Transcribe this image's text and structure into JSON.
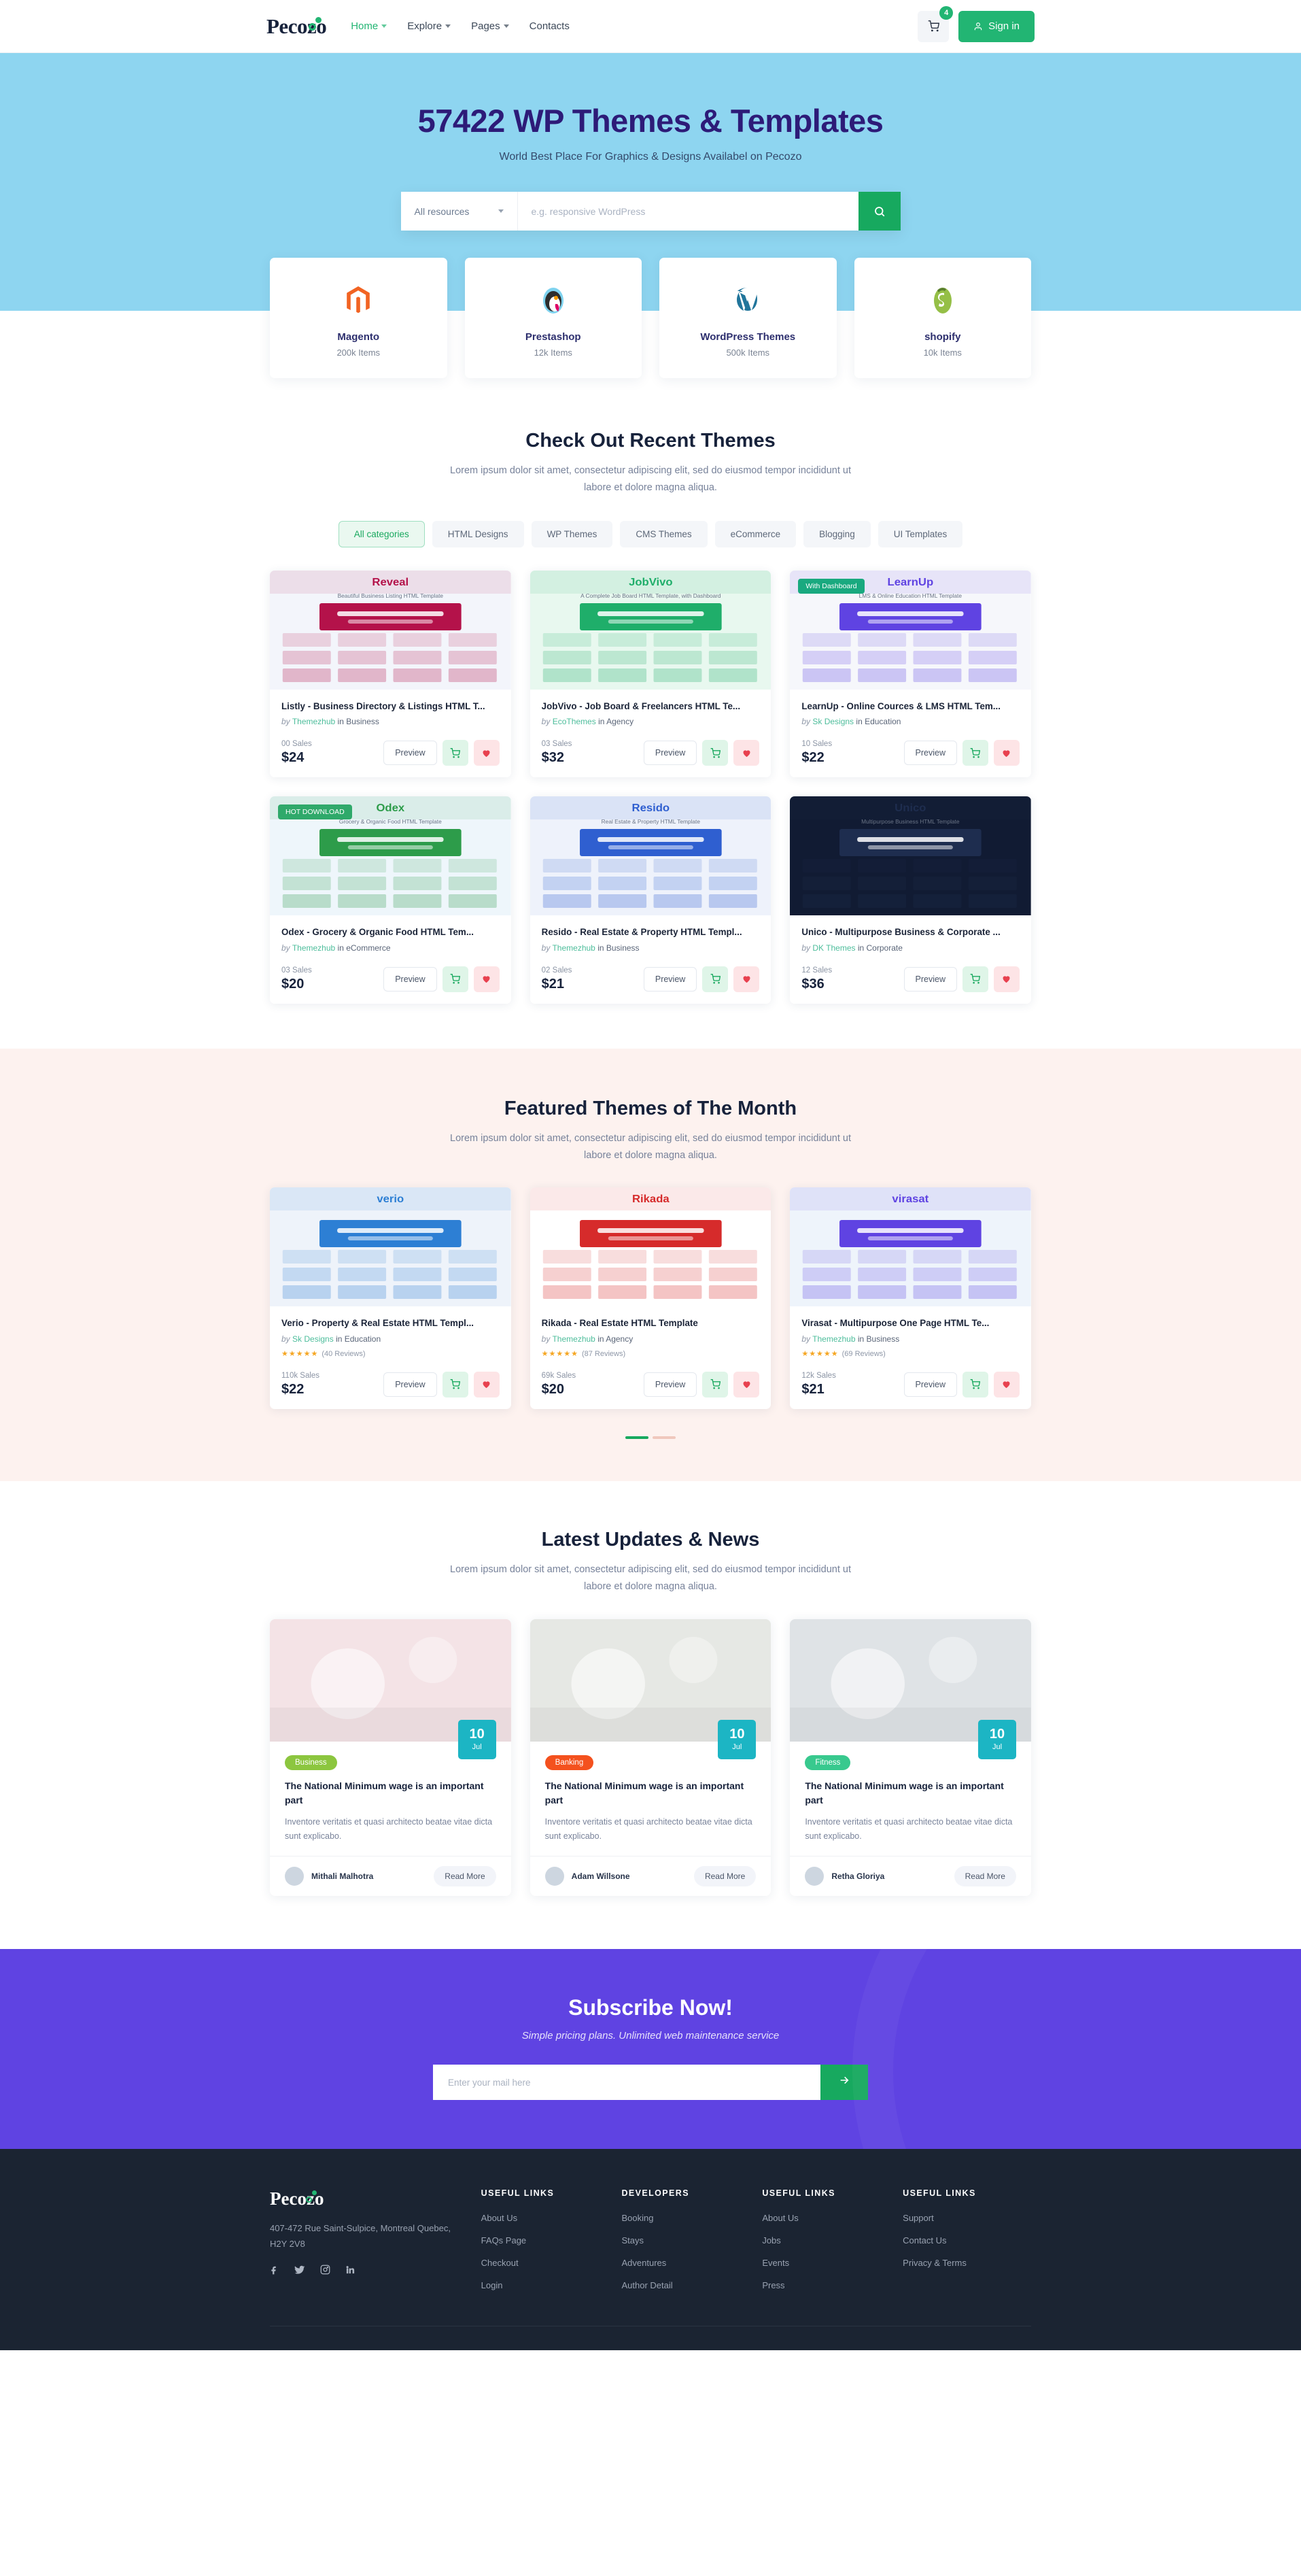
{
  "header": {
    "logo": "Pecozo",
    "nav": [
      {
        "label": "Home",
        "caret": true,
        "active": true
      },
      {
        "label": "Explore",
        "caret": true,
        "active": false
      },
      {
        "label": "Pages",
        "caret": true,
        "active": false
      },
      {
        "label": "Contacts",
        "caret": false,
        "active": false
      }
    ],
    "cart_count": "4",
    "signin_label": "Sign in"
  },
  "hero": {
    "title": "57422 WP Themes & Templates",
    "subtitle": "World Best Place For Graphics & Designs Availabel on Pecozo",
    "select_value": "All resources",
    "search_placeholder": "e.g. responsive WordPress",
    "search_icon": "search-icon"
  },
  "categories": [
    {
      "name": "Magento",
      "items": "200k Items",
      "icon": "magento-icon",
      "color": "#f26322"
    },
    {
      "name": "Prestashop",
      "items": "12k Items",
      "icon": "prestashop-icon",
      "color": "#df0067"
    },
    {
      "name": "WordPress Themes",
      "items": "500k Items",
      "icon": "wordpress-icon",
      "color": "#21759b"
    },
    {
      "name": "shopify",
      "items": "10k Items",
      "icon": "shopify-icon",
      "color": "#95bf47"
    }
  ],
  "recent": {
    "title": "Check Out Recent Themes",
    "desc": "Lorem ipsum dolor sit amet, consectetur adipiscing elit, sed do eiusmod tempor incididunt ut labore et dolore magna aliqua.",
    "tabs": [
      "All categories",
      "HTML Designs",
      "WP Themes",
      "CMS Themes",
      "eCommerce",
      "Blogging",
      "UI Templates"
    ],
    "active_tab": "All categories",
    "items": [
      {
        "title": "Listly - Business Directory & Listings HTML T...",
        "author": "Themezhub",
        "category": "Business",
        "sales": "00 Sales",
        "price": "$24",
        "preview": "Preview",
        "badge": "",
        "thumb_title": "Reveal",
        "thumb_sub": "Beautiful Business Listing HTML Template",
        "thumb_bg": "#f3f5fb",
        "accent": "#b4124a"
      },
      {
        "title": "JobVivo - Job Board & Freelancers HTML Te...",
        "author": "EcoThemes",
        "category": "Agency",
        "sales": "03 Sales",
        "price": "$32",
        "preview": "Preview",
        "badge": "",
        "thumb_title": "JobVivo",
        "thumb_sub": "A Complete Job Board HTML Template, with Dashboard",
        "thumb_bg": "#e8f8ef",
        "accent": "#1fae6a"
      },
      {
        "title": "LearnUp - Online Cources & LMS HTML Tem...",
        "author": "Sk Designs",
        "category": "Education",
        "sales": "10 Sales",
        "price": "$22",
        "preview": "Preview",
        "badge": "With Dashboard",
        "thumb_title": "LearnUp",
        "thumb_sub": "LMS & Online Education HTML Template",
        "thumb_bg": "#f6f7fb",
        "accent": "#5f43e2"
      },
      {
        "title": "Odex - Grocery & Organic Food HTML Tem...",
        "author": "Themezhub",
        "category": "eCommerce",
        "sales": "03 Sales",
        "price": "$20",
        "preview": "Preview",
        "badge": "HOT DOWNLOAD",
        "thumb_title": "Odex",
        "thumb_sub": "Grocery & Organic Food HTML Template",
        "thumb_bg": "#eef6fb",
        "accent": "#2d9c4a"
      },
      {
        "title": "Resido - Real Estate & Property HTML Templ...",
        "author": "Themezhub",
        "category": "Business",
        "sales": "02 Sales",
        "price": "$21",
        "preview": "Preview",
        "badge": "",
        "thumb_title": "Resido",
        "thumb_sub": "Real Estate & Property HTML Template",
        "thumb_bg": "#eef2fb",
        "accent": "#2f5fd0"
      },
      {
        "title": "Unico - Multipurpose Business & Corporate ...",
        "author": "DK Themes",
        "category": "Corporate",
        "sales": "12 Sales",
        "price": "$36",
        "preview": "Preview",
        "badge": "",
        "thumb_title": "Unico",
        "thumb_sub": "Multipurpose Business HTML Template",
        "thumb_bg": "#111b33",
        "accent": "#1e2d4f"
      }
    ]
  },
  "featured": {
    "title": "Featured Themes of The Month",
    "desc": "Lorem ipsum dolor sit amet, consectetur adipiscing elit, sed do eiusmod tempor incididunt ut labore et dolore magna aliqua.",
    "items": [
      {
        "title": "Verio - Property & Real Estate HTML Templ...",
        "author": "Sk Designs",
        "category": "Education",
        "stars": "★★★★★",
        "reviews": "(40 Reviews)",
        "sales": "110k Sales",
        "price": "$22",
        "preview": "Preview",
        "thumb_title": "verio",
        "thumb_bg": "#eef3fa",
        "accent": "#2d7fd4"
      },
      {
        "title": "Rikada - Real Estate HTML Template",
        "author": "Themezhub",
        "category": "Agency",
        "stars": "★★★★★",
        "reviews": "(87 Reviews)",
        "sales": "69k Sales",
        "price": "$20",
        "preview": "Preview",
        "thumb_title": "Rikada",
        "thumb_bg": "#ffffff",
        "accent": "#d62b2b"
      },
      {
        "title": "Virasat - Multipurpose One Page HTML Te...",
        "author": "Themezhub",
        "category": "Business",
        "stars": "★★★★★",
        "reviews": "(69 Reviews)",
        "sales": "12k Sales",
        "price": "$21",
        "preview": "Preview",
        "thumb_title": "virasat",
        "thumb_bg": "#eef4fb",
        "accent": "#5f43e2"
      }
    ]
  },
  "news": {
    "title": "Latest Updates & News",
    "desc": "Lorem ipsum dolor sit amet, consectetur adipiscing elit, sed do eiusmod tempor incididunt ut labore et dolore magna aliqua.",
    "items": [
      {
        "tag": "Business",
        "tag_color": "#8cc63f",
        "day": "10",
        "month": "Jul",
        "title": "The National Minimum wage is an important part",
        "excerpt": "Inventore veritatis et quasi architecto beatae vitae dicta sunt explicabo.",
        "author": "Mithali Malhotra",
        "read_more": "Read More",
        "img_bg": "#f4e3e6"
      },
      {
        "tag": "Banking",
        "tag_color": "#f4511e",
        "day": "10",
        "month": "Jul",
        "title": "The National Minimum wage is an important part",
        "excerpt": "Inventore veritatis et quasi architecto beatae vitae dicta sunt explicabo.",
        "author": "Adam Willsone",
        "read_more": "Read More",
        "img_bg": "#e6e8e4"
      },
      {
        "tag": "Fitness",
        "tag_color": "#38c98e",
        "day": "10",
        "month": "Jul",
        "title": "The National Minimum wage is an important part",
        "excerpt": "Inventore veritatis et quasi architecto beatae vitae dicta sunt explicabo.",
        "author": "Retha Gloriya",
        "read_more": "Read More",
        "img_bg": "#dfe3e6"
      }
    ]
  },
  "subscribe": {
    "title": "Subscribe Now!",
    "subtitle": "Simple pricing plans. Unlimited web maintenance service",
    "placeholder": "Enter your mail here",
    "button_icon": "arrow-right-icon"
  },
  "footer": {
    "logo": "Pecozo",
    "address": "407-472 Rue Saint-Sulpice, Montreal Quebec, H2Y 2V8",
    "socials": [
      "facebook-icon",
      "twitter-icon",
      "instagram-icon",
      "linkedin-icon"
    ],
    "columns": [
      {
        "heading": "USEFUL LINKS",
        "links": [
          "About Us",
          "FAQs Page",
          "Checkout",
          "Login"
        ]
      },
      {
        "heading": "DEVELOPERS",
        "links": [
          "Booking",
          "Stays",
          "Adventures",
          "Author Detail"
        ]
      },
      {
        "heading": "USEFUL LINKS",
        "links": [
          "About Us",
          "Jobs",
          "Events",
          "Press"
        ]
      },
      {
        "heading": "USEFUL LINKS",
        "links": [
          "Support",
          "Contact Us",
          "Privacy & Terms"
        ]
      }
    ]
  }
}
